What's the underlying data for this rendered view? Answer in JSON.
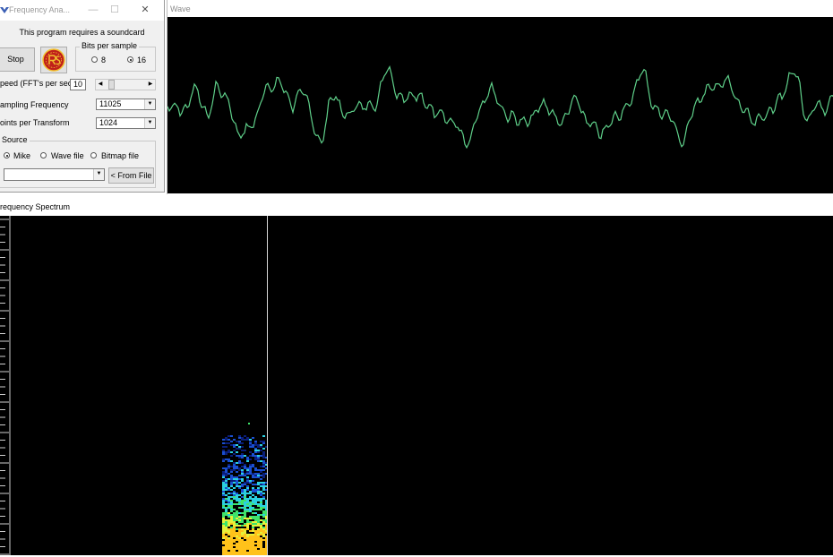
{
  "dialog": {
    "title": "Frequency Ana...",
    "minimize": "—",
    "maximize": "☐",
    "close": "✕",
    "notice": "This program requires a soundcard",
    "stop_label": "Stop",
    "bits_group": {
      "label": "Bits per sample",
      "options": [
        {
          "label": "8",
          "selected": false
        },
        {
          "label": "16",
          "selected": true
        }
      ]
    },
    "speed": {
      "label": "peed (FFT's per sec)",
      "value": "10"
    },
    "sampling": {
      "label": "ampling Frequency",
      "value": "11025"
    },
    "points": {
      "label": "oints per Transform",
      "value": "1024"
    },
    "source_group": {
      "label": "Source",
      "options": [
        {
          "label": "Mike",
          "selected": true
        },
        {
          "label": "Wave file",
          "selected": false
        },
        {
          "label": "Bitmap file",
          "selected": false
        }
      ],
      "file_value": "",
      "file_button": "< From File"
    }
  },
  "wave": {
    "title": "Wave",
    "trace_color": "#5fd08a"
  },
  "spectrum": {
    "title": "requency Spectrum",
    "marker_color": "#d8d8d8",
    "palette": [
      "#0a1e7a",
      "#1a4fd0",
      "#2bd0e0",
      "#3fe36a",
      "#e6f03a",
      "#ffc21a"
    ]
  },
  "icons": {
    "app": "app-logo-icon",
    "logo_button": "rs-logo-icon",
    "combo": "chevron-down-icon",
    "scroll_left": "arrow-left-icon",
    "scroll_right": "arrow-right-icon"
  }
}
